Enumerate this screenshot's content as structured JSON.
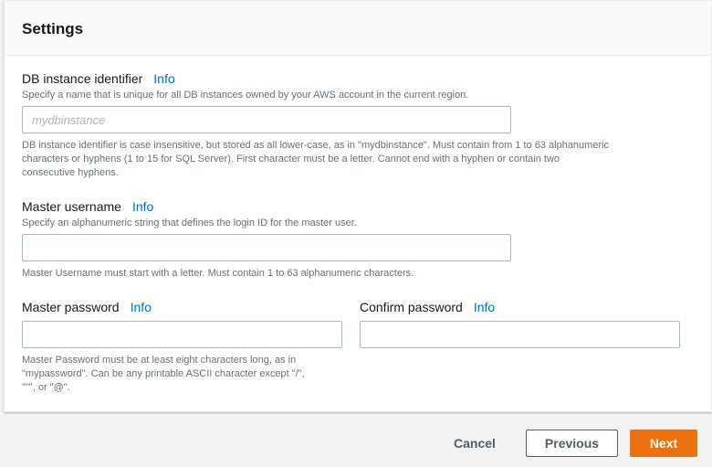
{
  "settings": {
    "title": "Settings",
    "db_identifier": {
      "label": "DB instance identifier",
      "info": "Info",
      "description": "Specify a name that is unique for all DB instances owned by your AWS account in the current region.",
      "placeholder": "mydbinstance",
      "value": "",
      "constraint_lines": [
        "DB instance identifier is case insensitive, but stored as all lower-case, as in \"mydbinstance\". Must contain from 1 to 63 alphanumeric",
        "characters or hyphens (1 to 15 for SQL Server). First character must be a letter. Cannot end with a hyphen or contain two",
        "consecutive hyphens."
      ]
    },
    "master_username": {
      "label": "Master username",
      "info": "Info",
      "description": "Specify an alphanumeric string that defines the login ID for the master user.",
      "value": "",
      "constraint": "Master Username must start with a letter. Must contain 1 to 63 alphanumeric characters."
    },
    "master_password": {
      "label": "Master password",
      "info": "Info",
      "value": "",
      "constraint_lines": [
        "Master Password must be at least eight characters long, as in",
        "\"mypassword\". Can be any printable ASCII character except \"/\",",
        "\"\"\", or \"@\"."
      ]
    },
    "confirm_password": {
      "label": "Confirm password",
      "info": "Info",
      "value": ""
    }
  },
  "footer": {
    "cancel_label": "Cancel",
    "previous_label": "Previous",
    "next_label": "Next"
  },
  "colors": {
    "accent": "#ec7211",
    "link": "#0073bb",
    "secondary_text": "#687078"
  }
}
